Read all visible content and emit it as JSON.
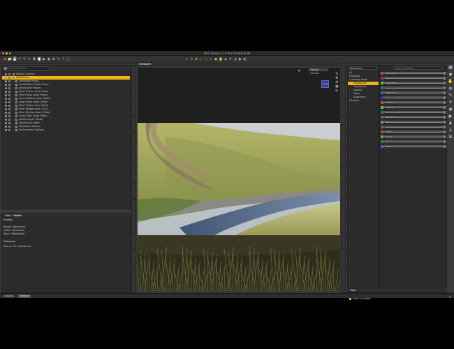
{
  "app": {
    "title": "DAZ Studio 4.16 Pro Private Build",
    "traffic_colors": [
      "#ff5f57",
      "#febc2e",
      "#28c840"
    ]
  },
  "toolbar": {
    "left_icons": [
      "menu-icon",
      "open-icon",
      "save-icon",
      "undo-icon",
      "redo-icon",
      "cut-icon",
      "copy-icon",
      "paste-icon",
      "render-icon",
      "preview-icon",
      "settings-icon",
      "script-icon",
      "help-icon",
      "info-icon"
    ],
    "center_icons": [
      "pointer-icon",
      "rotate-icon",
      "translate-icon",
      "scale-icon",
      "universal-icon",
      "joint-icon",
      "geometry-icon",
      "hand-icon",
      "morph-icon",
      "light-icon",
      "camera-icon",
      "render-icon",
      "spot-icon"
    ],
    "accent": "#f0a21a"
  },
  "scene_panel": {
    "search_placeholder": "Search Scene",
    "items": [
      {
        "label": "Default Camera",
        "indent": 0,
        "selected": false
      },
      {
        "label": "UltraScene",
        "indent": 0,
        "selected": true
      },
      {
        "label": "Ultrascene Proxy",
        "indent": 1,
        "selected": false
      },
      {
        "label": "LandMaster Terrain Proxy",
        "indent": 1,
        "selected": false
      },
      {
        "label": "UltraScene Proxies",
        "indent": 1,
        "selected": false
      },
      {
        "label": "Short Grass Layer (Vista)",
        "indent": 1,
        "selected": false
      },
      {
        "label": "Plain Grass Layer (Field)",
        "indent": 1,
        "selected": false
      },
      {
        "label": "Rural Pebbles Layer (Field)",
        "indent": 1,
        "selected": false
      },
      {
        "label": "Long Grass Layer (Vista)",
        "indent": 1,
        "selected": false
      },
      {
        "label": "Short Grass Layer (Field)",
        "indent": 1,
        "selected": false
      },
      {
        "label": "River Pebble Layer (CYC)",
        "indent": 1,
        "selected": false
      },
      {
        "label": "River Shrimp Layer (Vista)",
        "indent": 1,
        "selected": false
      },
      {
        "label": "Grass Tufts Layer (Field)",
        "indent": 1,
        "selected": false
      },
      {
        "label": "Upland Layer (Vista)",
        "indent": 1,
        "selected": false
      },
      {
        "label": "UltraScene Sprite",
        "indent": 1,
        "selected": false
      },
      {
        "label": "Treshaper Options",
        "indent": 1,
        "selected": false
      },
      {
        "label": "Environment Options",
        "indent": 1,
        "selected": false
      }
    ],
    "lower_tabs": [
      "Tool",
      "Notes"
    ],
    "info_header": "Presets",
    "info_lines": [
      "Name: UltraScene",
      "Label: UltraScene",
      "Type: Offset/Node"
    ],
    "meta_header": "Metadata",
    "meta_lines": [
      "Source: UF: UltraScene"
    ]
  },
  "viewport": {
    "tab": "Viewport",
    "camera_dropdown": "Default Camera",
    "cube_label": "Front"
  },
  "params_panel": {
    "tree_header": "UltraScene",
    "tree_items": [
      {
        "label": "All",
        "selected": false,
        "indent": 0
      },
      {
        "label": "Favorites",
        "selected": false,
        "indent": 0
      },
      {
        "label": "Currently Used",
        "selected": false,
        "indent": 0
      },
      {
        "label": "UltraScene",
        "selected": true,
        "indent": 1
      },
      {
        "label": "Transforms",
        "selected": false,
        "indent": 1
      },
      {
        "label": "Display",
        "selected": false,
        "indent": 1
      },
      {
        "label": "Mesh",
        "selected": false,
        "indent": 1
      },
      {
        "label": "Scattering",
        "selected": false,
        "indent": 1
      },
      {
        "label": "Shading",
        "selected": false,
        "indent": 0
      }
    ],
    "search_placeholder": "Filter Properties",
    "properties": [
      {
        "name": "X Translate",
        "color": "#c44"
      },
      {
        "name": "",
        "color": "#8a3a3a"
      },
      {
        "name": "Y Translate",
        "color": "#5b5"
      },
      {
        "name": "",
        "color": "#3a7a3a"
      },
      {
        "name": "Z Translate",
        "color": "#55c"
      },
      {
        "name": "",
        "color": "#3a3a8a"
      },
      {
        "name": "X Rotate",
        "color": "#c44"
      },
      {
        "name": "Y Rotate",
        "color": "#5b5"
      },
      {
        "name": "",
        "color": "#3a7a3a"
      },
      {
        "name": "Z Rotate",
        "color": "#55c"
      },
      {
        "name": "Scale",
        "color": "#888"
      },
      {
        "name": "",
        "color": "#666"
      },
      {
        "name": "X Scale",
        "color": "#c44"
      },
      {
        "name": "Y Scale",
        "color": "#5b5"
      },
      {
        "name": "",
        "color": "#3a7a3a"
      },
      {
        "name": "Z Scale",
        "color": "#55c"
      }
    ],
    "checkbox_label": "Show Sub Items",
    "bottom_tab": "Tips"
  },
  "status": {
    "tabs": [
      "Lessons",
      "Timeline"
    ],
    "active": 1
  }
}
